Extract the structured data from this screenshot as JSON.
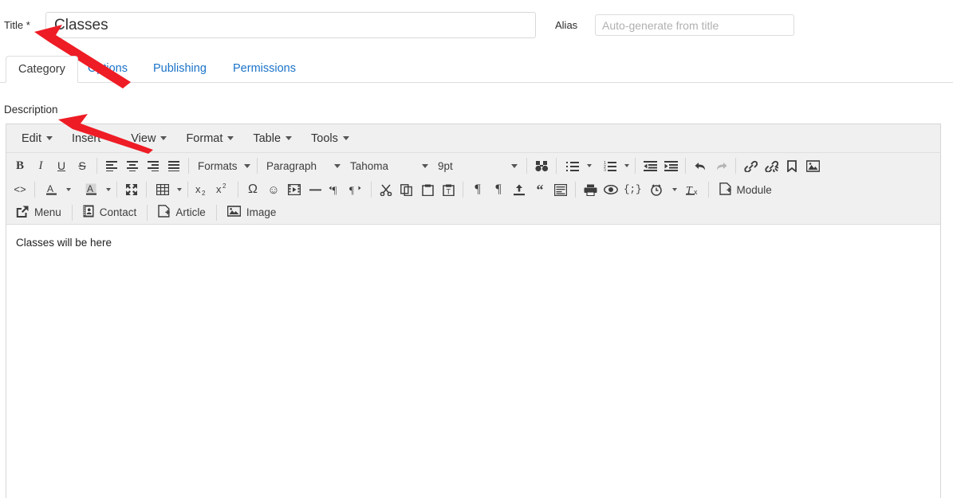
{
  "form": {
    "title_label": "Title *",
    "title_value": "Classes",
    "alias_label": "Alias",
    "alias_placeholder": "Auto-generate from title",
    "description_label": "Description"
  },
  "tabs": [
    {
      "label": "Category",
      "active": true
    },
    {
      "label": "Options",
      "active": false
    },
    {
      "label": "Publishing",
      "active": false
    },
    {
      "label": "Permissions",
      "active": false
    }
  ],
  "editor": {
    "menubar": [
      "Edit",
      "Insert",
      "View",
      "Format",
      "Table",
      "Tools"
    ],
    "selects": {
      "formats": "Formats",
      "paragraph": "Paragraph",
      "fontfamily": "Tahoma",
      "fontsize": "9pt"
    },
    "row3_buttons": [
      {
        "label": "Menu",
        "icon": "menu-share-icon"
      },
      {
        "label": "Contact",
        "icon": "contact-card-icon"
      },
      {
        "label": "Article",
        "icon": "article-page-icon"
      },
      {
        "label": "Image",
        "icon": "image-picture-icon"
      }
    ],
    "module_button": "Module",
    "content": "Classes will be here"
  },
  "colors": {
    "link": "#1a73c8",
    "toolbar_bg": "#f0f0f0",
    "border": "#d6d6d6",
    "annotation_arrow": "#ee1c25"
  },
  "annotations": [
    {
      "name": "arrow-to-title-label",
      "color": "#ee1c25"
    },
    {
      "name": "arrow-to-description-label",
      "color": "#ee1c25"
    }
  ]
}
